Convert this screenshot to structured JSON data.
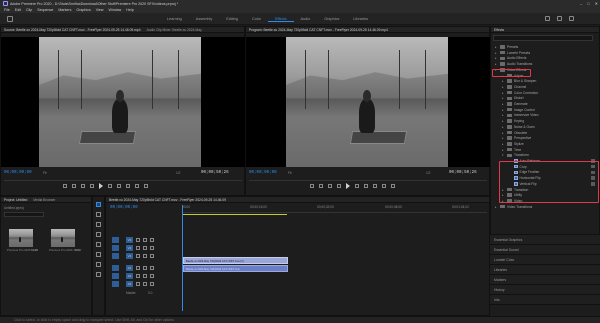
{
  "app": {
    "title": "Adobe Premiere Pro 2020 - D:\\Stuts\\Smitha\\Download\\Other Stuff\\Premiere Pro 2020 SFX\\videos.prproj *",
    "window_controls": [
      "–",
      "□",
      "✕"
    ]
  },
  "menu": [
    "File",
    "Edit",
    "Clip",
    "Sequence",
    "Markers",
    "Graphics",
    "View",
    "Window",
    "Help"
  ],
  "workspaces": {
    "tabs": [
      "Learning",
      "Assembly",
      "Editing",
      "Color",
      "Effects",
      "Audio",
      "Graphics",
      "Libraries"
    ],
    "active": "Effects"
  },
  "source_monitor": {
    "tabs": [
      "Source: Beetle.xu 2024-May 720p5fold CAT CNFT.mov - FreeFlyer 2024-09-25 14.46.09.mp4",
      "Audio Clip Mixer: Beetle.xu 2024-May"
    ],
    "timecode": "00;00;00;00",
    "fit": "Fit",
    "duration": "00;00;50;26",
    "page": "1/2"
  },
  "program_monitor": {
    "tabs": [
      "Program: Beetle.xu 2024-May 720p5fold CAT CNFT.mov - FreeFlyer 2024-09-25 14.46.09.mp4"
    ],
    "timecode": "00;00;00;00",
    "fit": "Fit",
    "duration": "00;00;50;26",
    "page": "1/2"
  },
  "effects_panel": {
    "tab": "Effects",
    "items": [
      {
        "label": "Presets",
        "type": "folder",
        "depth": 0,
        "expanded": false
      },
      {
        "label": "Lumetri Presets",
        "type": "folder",
        "depth": 0,
        "expanded": false
      },
      {
        "label": "Audio Effects",
        "type": "folder",
        "depth": 0,
        "expanded": false
      },
      {
        "label": "Audio Transitions",
        "type": "folder",
        "depth": 0,
        "expanded": false
      },
      {
        "label": "Video Effects",
        "type": "folder",
        "depth": 0,
        "expanded": true
      },
      {
        "label": "Adjust",
        "type": "folder",
        "depth": 1,
        "expanded": false
      },
      {
        "label": "Blur & Sharpen",
        "type": "folder",
        "depth": 1,
        "expanded": false
      },
      {
        "label": "Channel",
        "type": "folder",
        "depth": 1,
        "expanded": false
      },
      {
        "label": "Color Correction",
        "type": "folder",
        "depth": 1,
        "expanded": false
      },
      {
        "label": "Distort",
        "type": "folder",
        "depth": 1,
        "expanded": false
      },
      {
        "label": "Generate",
        "type": "folder",
        "depth": 1,
        "expanded": false
      },
      {
        "label": "Image Control",
        "type": "folder",
        "depth": 1,
        "expanded": false
      },
      {
        "label": "Immersive Video",
        "type": "folder",
        "depth": 1,
        "expanded": false
      },
      {
        "label": "Keying",
        "type": "folder",
        "depth": 1,
        "expanded": false
      },
      {
        "label": "Noise & Grain",
        "type": "folder",
        "depth": 1,
        "expanded": false
      },
      {
        "label": "Obsolete",
        "type": "folder",
        "depth": 1,
        "expanded": false
      },
      {
        "label": "Perspective",
        "type": "folder",
        "depth": 1,
        "expanded": false
      },
      {
        "label": "Stylize",
        "type": "folder",
        "depth": 1,
        "expanded": false
      },
      {
        "label": "Time",
        "type": "folder",
        "depth": 1,
        "expanded": false
      },
      {
        "label": "Transform",
        "type": "folder",
        "depth": 1,
        "expanded": true
      },
      {
        "label": "Auto Reframe",
        "type": "effect",
        "depth": 2
      },
      {
        "label": "Crop",
        "type": "effect",
        "depth": 2
      },
      {
        "label": "Edge Feather",
        "type": "effect",
        "depth": 2
      },
      {
        "label": "Horizontal Flip",
        "type": "effect",
        "depth": 2
      },
      {
        "label": "Vertical Flip",
        "type": "effect",
        "depth": 2
      },
      {
        "label": "Transition",
        "type": "folder",
        "depth": 1,
        "expanded": false
      },
      {
        "label": "Utility",
        "type": "folder",
        "depth": 1,
        "expanded": false
      },
      {
        "label": "Video",
        "type": "folder",
        "depth": 1,
        "expanded": false
      },
      {
        "label": "Video Transitions",
        "type": "folder",
        "depth": 0,
        "expanded": false
      }
    ]
  },
  "side_panels": [
    "Essential Graphics",
    "Essential Sound",
    "Lumetri Color",
    "Libraries",
    "Markers",
    "History",
    "Info"
  ],
  "project_panel": {
    "tabs": [
      "Project: Untitled",
      "Media Browser"
    ],
    "name": "Untitled.prproj",
    "clips": [
      {
        "name": "Premiere Pro 2020 - 24fr",
        "duration": "50;26"
      },
      {
        "name": "Premiere Pro 2020 - 24fr",
        "duration": "50;26"
      }
    ]
  },
  "timeline": {
    "tab": "Beetle.xu 2024-May 720p5fold CAT CNFT.mov - FreeFlyer 2024-09-25 14.46.09",
    "timecode": "00;00;00;00",
    "ruler": [
      "00;00",
      "00;00;16;00",
      "00;00;32;00",
      "00;00;48;00",
      "00;01;04;02"
    ],
    "video_tracks": [
      "V3",
      "V2",
      "V1"
    ],
    "audio_tracks": [
      "A1",
      "A2",
      "A3"
    ],
    "master": "Master",
    "master_level": "0.0",
    "clip_video": "Beetle.xu 2024-May 720p5fold CAT CNFT.mov [V]",
    "clip_audio": "Beetle.xu 2024-May 720p5fold CAT CNFT.mov"
  },
  "status": "Click to select, or click in empty space and drag to marquee select. Use Shift, Alt, and Ctrl for other options.",
  "colors": {
    "accent": "#2d8ceb",
    "highlight": "#e0384d",
    "clip_video": "#9aa6d6",
    "clip_audio": "#6a7fc6"
  }
}
